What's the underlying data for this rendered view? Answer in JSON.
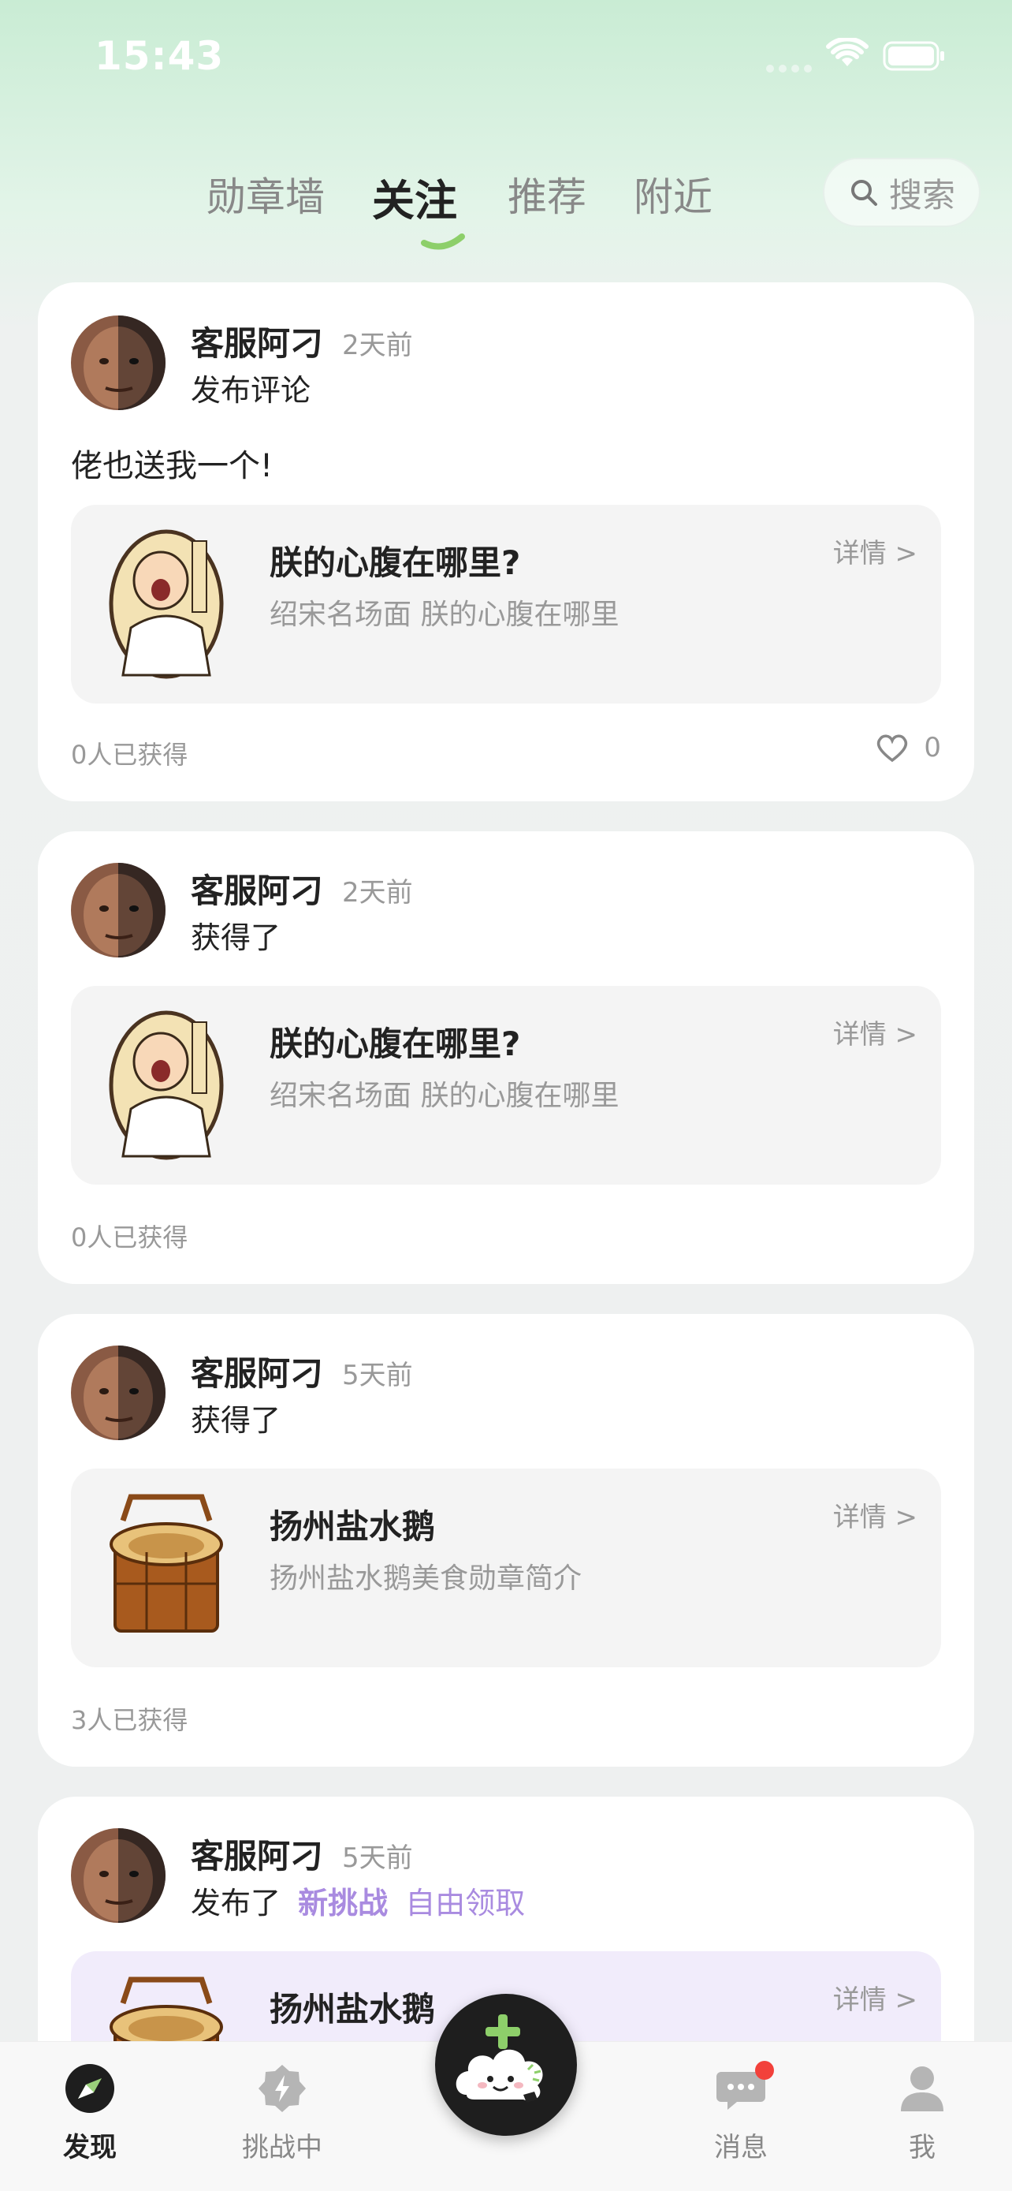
{
  "status_bar": {
    "time": "15:43"
  },
  "top_tabs": {
    "tabs": [
      "勋章墙",
      "关注",
      "推荐",
      "附近"
    ],
    "active_index": 1,
    "search_label": "搜索"
  },
  "feed": [
    {
      "username": "客服阿刁",
      "time": "2天前",
      "action": "发布评论",
      "comment": "佬也送我一个!",
      "badge": {
        "title": "朕的心腹在哪里?",
        "desc": "绍宋名场面 朕的心腹在哪里",
        "detail": "详情 >"
      },
      "obtained": "0人已获得",
      "likes": "0"
    },
    {
      "username": "客服阿刁",
      "time": "2天前",
      "action": "获得了",
      "badge": {
        "title": "朕的心腹在哪里?",
        "desc": "绍宋名场面 朕的心腹在哪里",
        "detail": "详情 >"
      },
      "obtained": "0人已获得"
    },
    {
      "username": "客服阿刁",
      "time": "5天前",
      "action": "获得了",
      "badge": {
        "title": "扬州盐水鹅",
        "desc": "扬州盐水鹅美食勋章简介",
        "detail": "详情 >"
      },
      "obtained": "3人已获得"
    },
    {
      "username": "客服阿刁",
      "time": "5天前",
      "action": "发布了",
      "action_accent_1": "新挑战",
      "action_accent_2": "自由领取",
      "badge": {
        "title": "扬州盐水鹅",
        "detail": "详情 >"
      }
    }
  ],
  "bottom_nav": {
    "items": [
      "发现",
      "挑战中",
      "消息",
      "我"
    ],
    "active_index": 0
  },
  "colors": {
    "accent_green": "#8dcf6a",
    "accent_purple": "#a98be0",
    "badge_red": "#f2413b"
  }
}
